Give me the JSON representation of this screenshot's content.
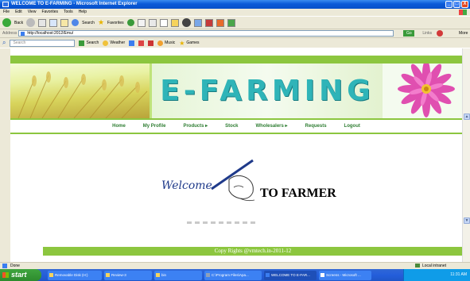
{
  "window": {
    "title": "WELCOME TO E-FARMING - Microsoft Internet Explorer",
    "controls": [
      "_",
      "□",
      "X"
    ]
  },
  "menu": [
    "File",
    "Edit",
    "View",
    "Favorites",
    "Tools",
    "Help"
  ],
  "toolbar": {
    "back_label": "Back",
    "search_label": "Search",
    "favorites_label": "Favorites"
  },
  "address": {
    "label": "Address",
    "url": "http://localhost:2012/Emu/",
    "go_label": "Go",
    "links_label": "Links",
    "more_label": "More"
  },
  "searchbar": {
    "placeholder": "Search",
    "search_label": "Search",
    "weather_label": "Weather",
    "music_label": "Music",
    "games_label": "Games"
  },
  "site": {
    "title": "E-FARMING",
    "nav": [
      "Home",
      "My Profile",
      "Products ▸",
      "Stock",
      "Wholesalers ▸",
      "Requests",
      "Logout"
    ],
    "welcome_script": "Welcome",
    "welcome_heading": "TO FARMER",
    "footer": "Copy Rights @vmtech.in-2011-12"
  },
  "status": {
    "text": "Done",
    "zone": "Local intranet"
  },
  "taskbar": {
    "start_label": "start",
    "tasks": [
      "Removable Disk (H:)",
      "Review-3",
      "bin",
      "C:\\Program Files\\Apa...",
      "WELCOME TO E-FAR...",
      "Screens - Microsoft ..."
    ],
    "clock": "11:31 AM"
  },
  "colors": {
    "accent_green": "#8cc63f",
    "title_teal": "#2fb4b8",
    "nav_text": "#2e7d32"
  }
}
